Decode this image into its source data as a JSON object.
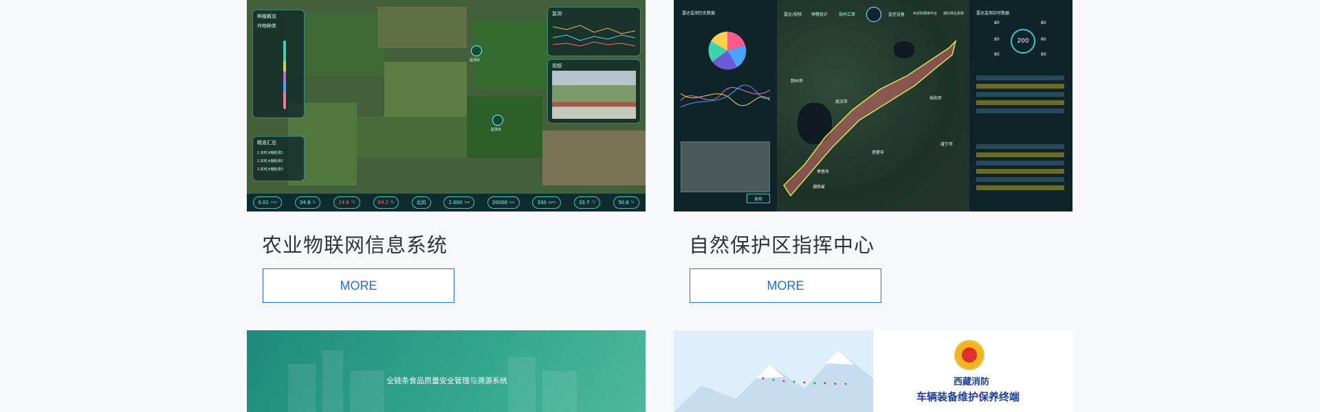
{
  "cards": [
    {
      "title": "农业物联网信息系统",
      "more_label": "MORE",
      "thumb": {
        "panel_left_title": "种植概览",
        "panel_left_sub": "作物种类",
        "panel_right_title": "监测",
        "panel_video_title": "视频",
        "panel_bottom_title": "精准汇总",
        "panel_bottom_items": [
          "1.实时大棚检测1",
          "2.实时大棚检测2",
          "3.实时大棚检测3"
        ],
        "map_labels": [
          "监测点",
          "监测点"
        ],
        "stats": [
          {
            "value": "0.01",
            "unit": "m/s",
            "color": "#7ff"
          },
          {
            "value": "34.8",
            "unit": "%",
            "color": "#7ff"
          },
          {
            "value": "24.6",
            "unit": "°C",
            "color": "#ff6b6b"
          },
          {
            "value": "69.2",
            "unit": "%",
            "color": "#ff6b6b"
          },
          {
            "value": "北风",
            "unit": "",
            "color": "#7ff"
          },
          {
            "value": "2.000",
            "unit": "lux",
            "color": "#7ff"
          },
          {
            "value": "20000",
            "unit": "lux",
            "color": "#7ff"
          },
          {
            "value": "330",
            "unit": "ppm",
            "color": "#7ff"
          },
          {
            "value": "33.7",
            "unit": "°C",
            "color": "#7ff"
          },
          {
            "value": "50.6",
            "unit": "%",
            "color": "#7ff"
          }
        ]
      }
    },
    {
      "title": "自然保护区指挥中心",
      "more_label": "MORE",
      "thumb": {
        "top_nav": [
          "雷达/视频",
          "预警统计",
          "协同工单",
          "监控设备",
          "AI识别通用平台",
          "湖北林业系统"
        ],
        "center_gauge": "200",
        "side_values": [
          "80",
          "80",
          "80",
          "80",
          "80",
          "80"
        ],
        "map_places": [
          "荆州市",
          "武汉市",
          "赤壁市",
          "咸宁市",
          "岳阳市",
          "湖南省",
          "孝感市"
        ],
        "left_panel_title": "雷达监测历史数据",
        "right_panel_title": "雷达监测实时数据",
        "submit_label": "发布"
      }
    }
  ],
  "bottom_cards": [
    {
      "banner": "全链条食品质量安全管理与溯源系统"
    },
    {
      "org": "西藏消防",
      "banner": "车辆装备维护保养终端"
    }
  ]
}
